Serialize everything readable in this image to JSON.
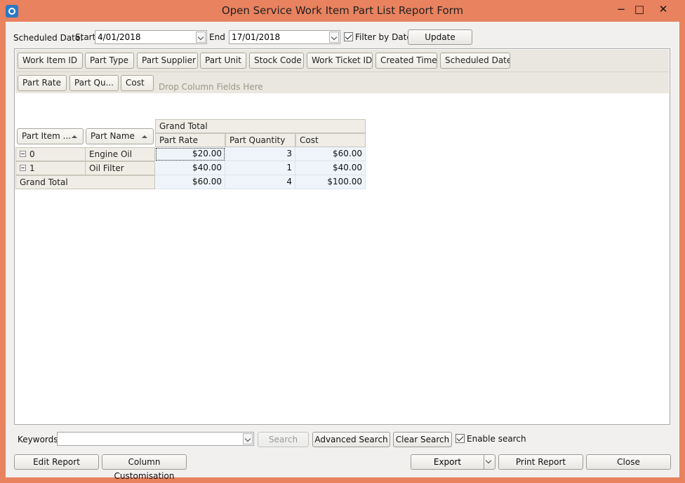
{
  "window": {
    "title": "Open Service Work Item Part List Report Form",
    "minimize_glyph": "−",
    "maximize_glyph": "□",
    "close_glyph": "✕"
  },
  "filter": {
    "scheduled_label": "Scheduled Date:",
    "start_label": "Start",
    "start_value": "4/01/2018",
    "end_label": "End",
    "end_value": "17/01/2018",
    "filter_by_date_label": "Filter by Date",
    "filter_by_date_checked": true,
    "update_label": "Update"
  },
  "pivot": {
    "filter_fields": [
      "Work Item ID",
      "Part Type",
      "Part Supplier",
      "Part Unit",
      "Stock Code",
      "Work Ticket ID",
      "Created Time",
      "Scheduled Date"
    ],
    "data_fields": [
      "Part Rate",
      "Part Qu...",
      "Cost"
    ],
    "drop_hint": "Drop Column Fields Here",
    "row_fields": [
      "Part Item ...",
      "Part Name"
    ],
    "grand_total_header": "Grand Total",
    "column_headers": [
      "Part Rate",
      "Part Quantity",
      "Cost"
    ],
    "rows": [
      {
        "id": "0",
        "name": "Engine Oil",
        "values": [
          "$20.00",
          "3",
          "$60.00"
        ]
      },
      {
        "id": "1",
        "name": "Oil Filter",
        "values": [
          "$40.00",
          "1",
          "$40.00"
        ]
      }
    ],
    "grand_total_label": "Grand Total",
    "grand_total_values": [
      "$60.00",
      "4",
      "$100.00"
    ]
  },
  "search": {
    "keywords_label": "Keywords:",
    "keywords_value": "",
    "search_label": "Search",
    "advanced_label": "Advanced Search",
    "clear_label": "Clear Search",
    "enable_label": "Enable search",
    "enable_checked": true
  },
  "footer": {
    "edit_report": "Edit Report",
    "column_customisation": "Column Customisation",
    "export": "Export",
    "print_report": "Print Report",
    "close": "Close"
  },
  "colors": {
    "window_frame": "#e9825f",
    "client_bg": "#f1f0ee",
    "data_cell_bg": "#eef4fa"
  }
}
